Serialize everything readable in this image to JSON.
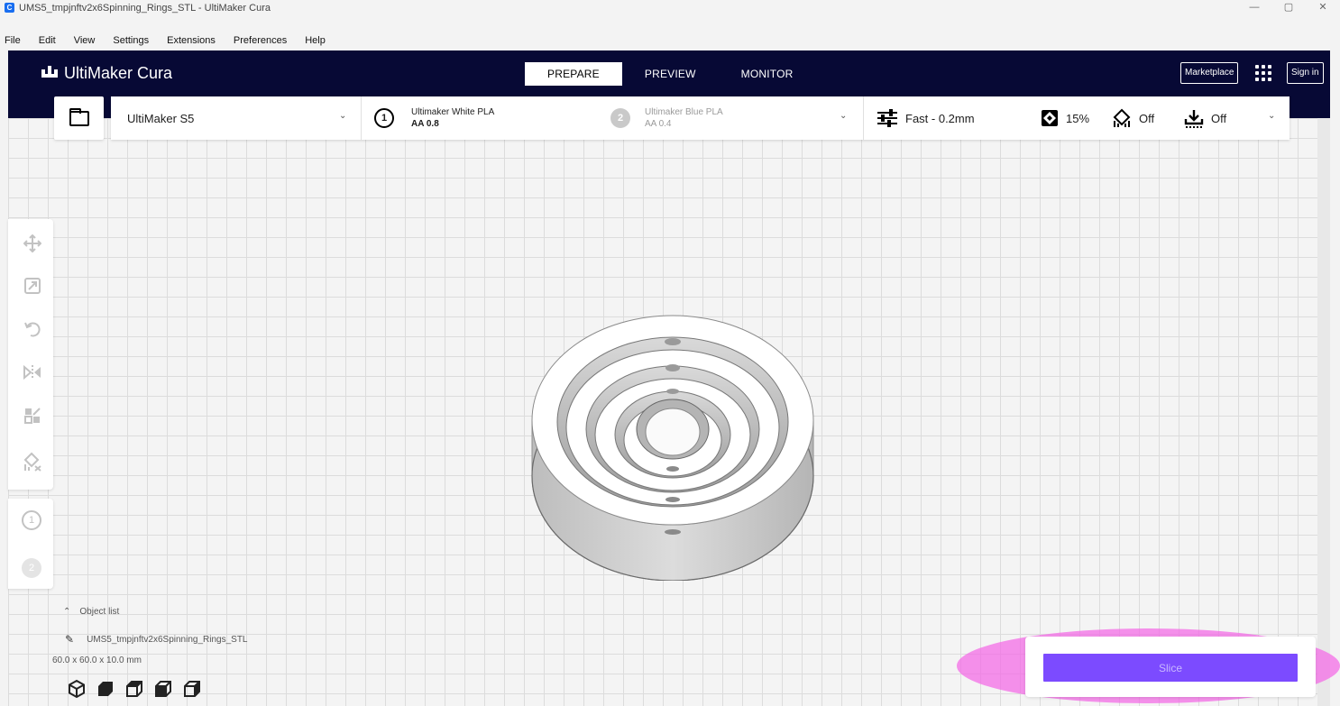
{
  "window": {
    "title": "UMS5_tmpjnftv2x6Spinning_Rings_STL - UltiMaker Cura",
    "app_icon_letter": "C",
    "controls": [
      "—",
      "▢",
      "✕"
    ]
  },
  "menu": [
    "File",
    "Edit",
    "View",
    "Settings",
    "Extensions",
    "Preferences",
    "Help"
  ],
  "header": {
    "logo_text": "UltiMaker Cura",
    "tabs": [
      {
        "label": "PREPARE",
        "active": true
      },
      {
        "label": "PREVIEW",
        "active": false
      },
      {
        "label": "MONITOR",
        "active": false
      }
    ],
    "marketplace_label": "Marketplace",
    "signin_label": "Sign in"
  },
  "stage": {
    "open_icon": "folder-icon",
    "printer": "UltiMaker S5",
    "extruder1": {
      "number": "1",
      "material": "Ultimaker White PLA",
      "core": "AA 0.8"
    },
    "extruder2": {
      "number": "2",
      "material": "Ultimaker Blue PLA",
      "core": "AA 0.4"
    },
    "profile": "Fast - 0.2mm",
    "infill": "15%",
    "support": "Off",
    "adhesion": "Off"
  },
  "tools": [
    "move-icon",
    "scale-icon",
    "rotate-icon",
    "mirror-icon",
    "per-model-settings-icon",
    "support-blocker-icon"
  ],
  "extruder_tools": [
    "1",
    "2"
  ],
  "object_list": {
    "header": "Object list",
    "item": "UMS5_tmpjnftv2x6Spinning_Rings_STL",
    "dimensions": "60.0 x 60.0 x 10.0 mm"
  },
  "slice": {
    "label": "Slice",
    "button_color": "#7c4bff"
  },
  "colors": {
    "header_bg": "#070935",
    "highlight": "#f468e6"
  }
}
